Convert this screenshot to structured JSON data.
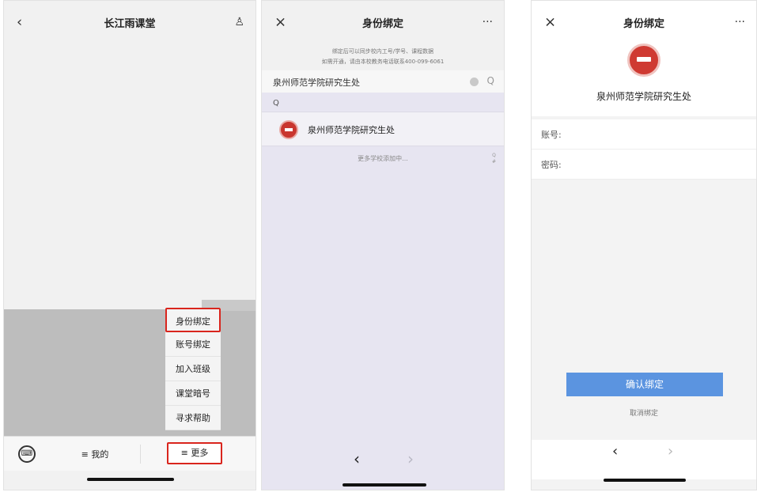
{
  "screen1": {
    "title": "长江雨课堂",
    "back_icon": "‹",
    "user_icon": "♙",
    "menu": [
      "身份绑定",
      "账号绑定",
      "加入班级",
      "课堂暗号",
      "寻求帮助"
    ],
    "tab_mine": "≡ 我的",
    "tab_more": "≡ 更多",
    "highlight_color": "#d9251d"
  },
  "screen2": {
    "title": "身份绑定",
    "close_icon": "×",
    "more_icon": "···",
    "notice_line1": "绑定后可以同步校内工号/学号、课程数据",
    "notice_line2": "如需开通，请由本校教务电话联系400-099-6061",
    "search_value": "泉州师范学院研究生处",
    "search_icon": "Q",
    "index_letter": "Q",
    "result_name": "泉州师范学院研究生处",
    "more_schools": "更多学校添加中...",
    "index_bar": "Q\n#",
    "nav_back": "‹",
    "nav_forward": "›"
  },
  "screen3": {
    "title": "身份绑定",
    "close_icon": "×",
    "more_icon": "···",
    "school": "泉州师范学院研究生处",
    "account_label": "账号:",
    "password_label": "密码:",
    "confirm": "确认绑定",
    "cancel": "取消绑定",
    "nav_back": "‹",
    "nav_forward": "›",
    "accent_color": "#5b94e0"
  }
}
